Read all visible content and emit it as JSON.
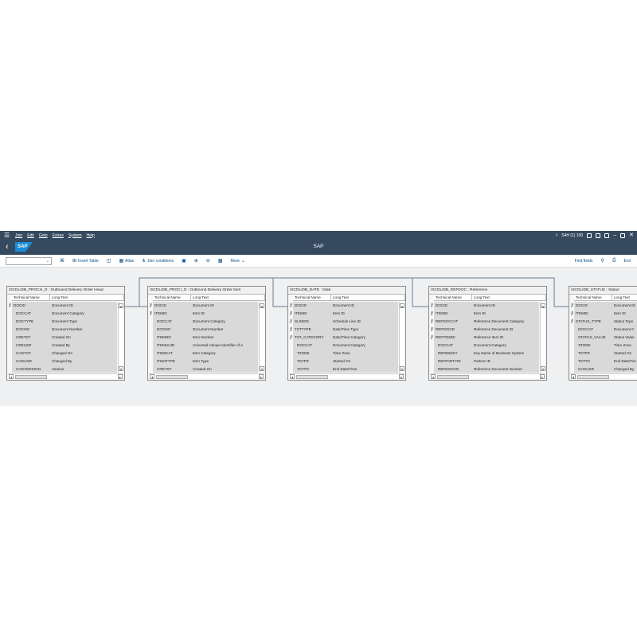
{
  "menubar": {
    "items": [
      "Join",
      "Edit",
      "Goto",
      "Extras",
      "System",
      "Help"
    ],
    "session": "S4H (1) 100"
  },
  "shell": {
    "title": "SAP",
    "logo": "SAP"
  },
  "toolbar": {
    "insert_table": "Insert Table",
    "alias": "Alias",
    "join_conditions": "Join conditions",
    "more": "More",
    "find_fields": "Find fields",
    "exit": "Exit"
  },
  "tables": [
    {
      "title": "/SCDL/DB_PROCH_O : Outbound Delivery Order Head",
      "col_tech": "Technical Name",
      "col_long": "Long Text",
      "rows": [
        {
          "tech": "DOCID",
          "long": "Document ID",
          "key": true
        },
        {
          "tech": "DOCCAT",
          "long": "Document Category",
          "key": false
        },
        {
          "tech": "DOCTYPE",
          "long": "Document Type",
          "key": false
        },
        {
          "tech": "DOCNO",
          "long": "Document Number",
          "key": false
        },
        {
          "tech": "CRETST",
          "long": "Created On",
          "key": false
        },
        {
          "tech": "CREUSR",
          "long": "Created By",
          "key": false
        },
        {
          "tech": "CHGTST",
          "long": "Changed On",
          "key": false
        },
        {
          "tech": "CHGUSR",
          "long": "Changed By",
          "key": false
        },
        {
          "tech": "CHGVERSION",
          "long": "Version",
          "key": false
        }
      ]
    },
    {
      "title": "/SCDL/DB_PROCI_O : Outbound Delivery Order Item",
      "col_tech": "Technical Name",
      "col_long": "Long Text",
      "rows": [
        {
          "tech": "DOCID",
          "long": "Document ID",
          "key": true
        },
        {
          "tech": "ITEMID",
          "long": "Item ID",
          "key": true
        },
        {
          "tech": "DOCCAT",
          "long": "Document Category",
          "key": false
        },
        {
          "tech": "DOCNO",
          "long": "Document Number",
          "key": false
        },
        {
          "tech": "ITEMNO",
          "long": "Item Number",
          "key": false
        },
        {
          "tech": "ITEMUUID",
          "long": "Universal Unique Identifier of a",
          "key": false
        },
        {
          "tech": "ITEMCAT",
          "long": "Item Category",
          "key": false
        },
        {
          "tech": "ITEMTYPE",
          "long": "Item Type",
          "key": false
        },
        {
          "tech": "CRETST",
          "long": "Created On",
          "key": false
        }
      ]
    },
    {
      "title": "/SCDL/DB_DATE : Date",
      "col_tech": "Technical Name",
      "col_long": "Long Text",
      "rows": [
        {
          "tech": "DOCID",
          "long": "Document ID",
          "key": true
        },
        {
          "tech": "ITEMID",
          "long": "Item ID",
          "key": true
        },
        {
          "tech": "SLINEID",
          "long": "Schedule Line ID",
          "key": true
        },
        {
          "tech": "TSTTYPE",
          "long": "Date/Time Type",
          "key": true
        },
        {
          "tech": "TST_CATEGORY",
          "long": "Date/Time Category",
          "key": true
        },
        {
          "tech": "DOCCAT",
          "long": "Document Category",
          "key": false
        },
        {
          "tech": "TZONE",
          "long": "Time Zone",
          "key": false
        },
        {
          "tech": "TSTFR",
          "long": "Started On",
          "key": false
        },
        {
          "tech": "TSTTO",
          "long": "End Date/Time",
          "key": false
        },
        {
          "tech": "DATE_INDICATOR",
          "long": "Value Determination Indicator",
          "key": false
        }
      ]
    },
    {
      "title": "/SCDL/DB_REFDOC : Reference",
      "col_tech": "Technical Name",
      "col_long": "Long Text",
      "rows": [
        {
          "tech": "DOCID",
          "long": "Document ID",
          "key": true
        },
        {
          "tech": "ITEMID",
          "long": "Item ID",
          "key": true
        },
        {
          "tech": "REFDOCCAT",
          "long": "Reference Document Category",
          "key": true
        },
        {
          "tech": "REFDOCID",
          "long": "Reference Document ID",
          "key": true
        },
        {
          "tech": "REFITEMID",
          "long": "Reference Item ID",
          "key": true
        },
        {
          "tech": "DOCCAT",
          "long": "Document Category",
          "key": false
        },
        {
          "tech": "REFBSKEY",
          "long": "Key Name of Business System",
          "key": false
        },
        {
          "tech": "REFPARTYID",
          "long": "Partner ID",
          "key": false
        },
        {
          "tech": "REFDOCNO",
          "long": "Reference Document Number",
          "key": false
        },
        {
          "tech": "REFITEMNO",
          "long": "Reference Item Number",
          "key": false
        }
      ]
    },
    {
      "title": "/SCDL/DB_STATUS : Status",
      "col_tech": "Technical Name",
      "col_long": "Long Text",
      "rows": [
        {
          "tech": "DOCID",
          "long": "Document ID",
          "key": true
        },
        {
          "tech": "ITEMID",
          "long": "Item ID",
          "key": true
        },
        {
          "tech": "STATUS_TYPE",
          "long": "Status Type",
          "key": true
        },
        {
          "tech": "DOCCAT",
          "long": "Document C",
          "key": false
        },
        {
          "tech": "STATUS_VALUE",
          "long": "Status Value",
          "key": false
        },
        {
          "tech": "TZONE",
          "long": "Time Zone",
          "key": false
        },
        {
          "tech": "TSTFR",
          "long": "Started On",
          "key": false
        },
        {
          "tech": "TSTTO",
          "long": "End Date/Tim",
          "key": false
        },
        {
          "tech": "CHGUSR",
          "long": "Changed By",
          "key": false
        }
      ]
    }
  ]
}
